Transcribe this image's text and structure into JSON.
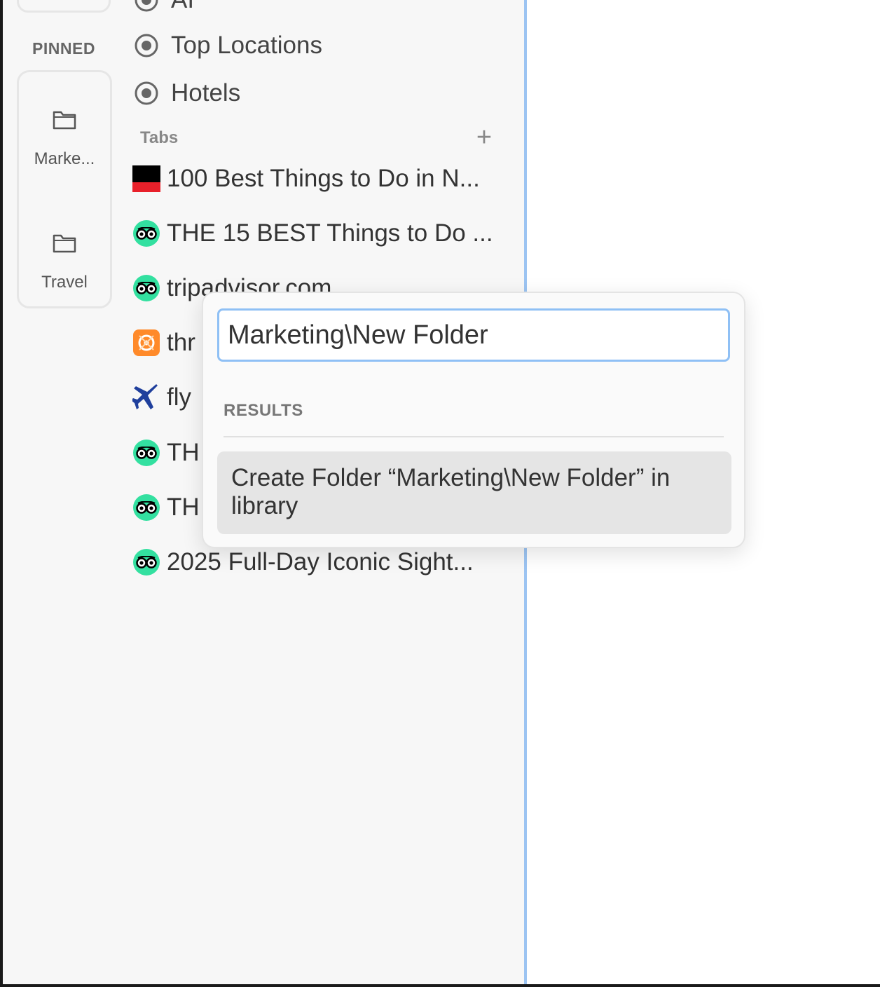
{
  "sidebar": {
    "pinned_heading": "PINNED",
    "pinned_folders": [
      {
        "label": "Marke..."
      },
      {
        "label": "Travel"
      }
    ],
    "locations": [
      {
        "label": "AI"
      },
      {
        "label": "Top Locations"
      },
      {
        "label": "Hotels"
      }
    ],
    "tabs_section": {
      "title": "Tabs",
      "add_label": "+"
    },
    "tabs": [
      {
        "title": "100 Best Things to Do in N...",
        "icon": "red-black-flag-icon"
      },
      {
        "title": "THE 15 BEST Things to Do ...",
        "icon": "tripadvisor-owl-icon"
      },
      {
        "title": "tripadvisor.com",
        "icon": "tripadvisor-owl-icon"
      },
      {
        "title": "thr",
        "icon": "orange-app-icon"
      },
      {
        "title": "fly",
        "icon": "airplane-icon"
      },
      {
        "title": "TH",
        "icon": "tripadvisor-owl-icon"
      },
      {
        "title": "TH",
        "icon": "tripadvisor-owl-icon"
      },
      {
        "title": "2025 Full-Day Iconic Sight...",
        "icon": "tripadvisor-owl-icon"
      }
    ]
  },
  "popup": {
    "input_value": "Marketing\\New Folder",
    "results_label": "RESULTS",
    "results": [
      {
        "label": "Create Folder “Marketing\\New Folder” in library"
      }
    ]
  },
  "colors": {
    "accent": "#8fc0f5",
    "divider": "#9cc4f2",
    "tripadvisor": "#33e0a0"
  }
}
